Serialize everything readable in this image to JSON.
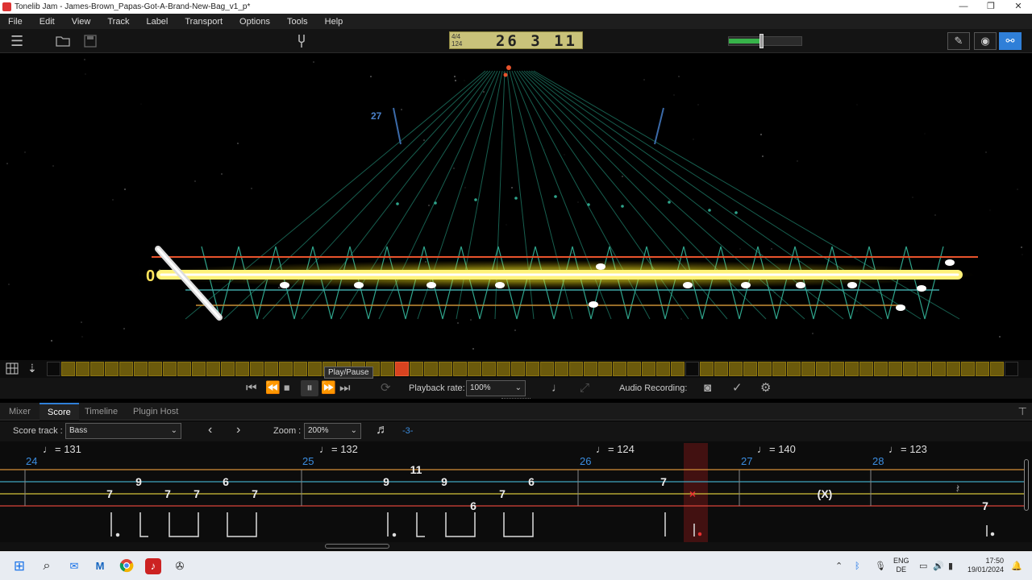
{
  "window": {
    "title": "Tonelib Jam - James-Brown_Papas-Got-A-Brand-New-Bag_v1_p*",
    "minimize": "—",
    "maximize": "❐",
    "close": "✕"
  },
  "menu": [
    "File",
    "Edit",
    "View",
    "Track",
    "Label",
    "Transport",
    "Options",
    "Tools",
    "Help"
  ],
  "toolbar": {
    "time_signature": "4/4",
    "tempo": "124",
    "position": "26 3 11",
    "volume": 0.46,
    "mode_buttons": [
      {
        "name": "pencil-icon",
        "glyph": "✎"
      },
      {
        "name": "eye-icon",
        "glyph": "◉"
      },
      {
        "name": "share-icon",
        "glyph": "⚯"
      }
    ]
  },
  "view3d": {
    "measure_label": "27",
    "fret_label": "0"
  },
  "tooltip": "Play/Pause",
  "transport": {
    "playback_rate_label": "Playback rate:",
    "playback_rate_value": "100%",
    "audio_recording_label": "Audio Recording:"
  },
  "tabs": [
    {
      "label": "Mixer",
      "active": false
    },
    {
      "label": "Score",
      "active": true
    },
    {
      "label": "Timeline",
      "active": false
    },
    {
      "label": "Plugin Host",
      "active": false
    }
  ],
  "scorebar": {
    "score_track_label": "Score track :",
    "score_track_value": "Bass",
    "zoom_label": "Zoom :",
    "zoom_value": "200%",
    "triplet_label": "-3-"
  },
  "score": {
    "measures": [
      {
        "number": "24",
        "tempo": "= 131"
      },
      {
        "number": "25",
        "tempo": "= 132"
      },
      {
        "number": "26",
        "tempo": "= 124"
      },
      {
        "number": "27",
        "tempo": "= 140"
      },
      {
        "number": "28",
        "tempo": "= 123"
      }
    ],
    "ghost_note": "(X)",
    "notes": [
      "7",
      "9",
      "7",
      "7",
      "6",
      "7",
      "9",
      "11",
      "9",
      "6",
      "7",
      "6",
      "7",
      "7"
    ]
  },
  "taskbar": {
    "language": "ENG",
    "region": "DE",
    "time": "17:50",
    "date": "19/01/2024"
  }
}
